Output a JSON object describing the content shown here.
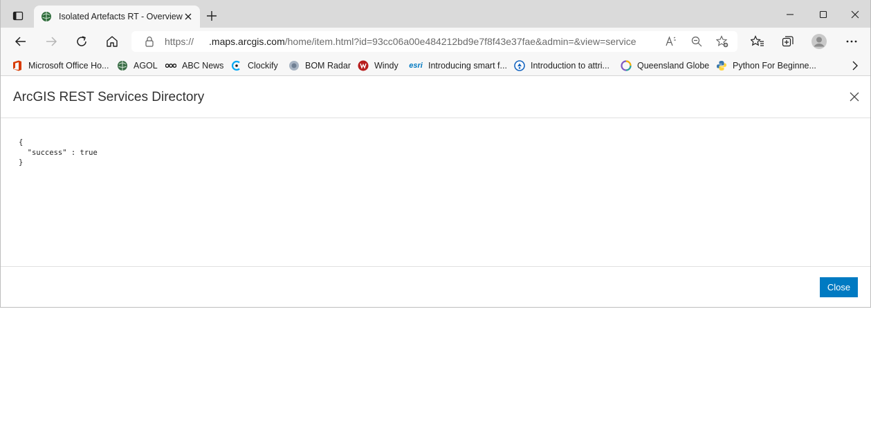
{
  "tab": {
    "title": "Isolated Artefacts RT - Overview"
  },
  "address": {
    "scheme": "https://",
    "host": ".maps.arcgis.com",
    "path": "/home/item.html?id=93cc06a00e484212bd9e7f8f43e37fae&admin=&view=service"
  },
  "favorites": [
    {
      "label": "Microsoft Office Ho...",
      "icon": "office-icon",
      "color": "#d83b01"
    },
    {
      "label": "AGOL",
      "icon": "globe-icon",
      "color": "#2e7d32"
    },
    {
      "label": "ABC News",
      "icon": "abc-icon",
      "color": "#111111"
    },
    {
      "label": "Clockify",
      "icon": "clockify-icon",
      "color": "#03a9f4"
    },
    {
      "label": "BOM Radar",
      "icon": "bom-icon",
      "color": "#8a9bb0"
    },
    {
      "label": "Windy",
      "icon": "windy-icon",
      "color": "#c62828"
    },
    {
      "label": "Introducing smart f...",
      "icon": "esri-icon",
      "color": "#0079c1"
    },
    {
      "label": "Introduction to attri...",
      "icon": "learn-icon",
      "color": "#1565c0"
    },
    {
      "label": "Queensland Globe",
      "icon": "qld-globe-icon",
      "color": "#7e57c2"
    },
    {
      "label": "Python For Beginne...",
      "icon": "python-icon",
      "color": "#3776ab"
    }
  ],
  "dialog": {
    "title": "ArcGIS REST Services Directory",
    "json_text": "{\n  \"success\" : true\n}",
    "close_button": "Close"
  },
  "colors": {
    "accent": "#007ac2",
    "tabbar": "#dadada",
    "toolbar": "#f7f7f7"
  }
}
